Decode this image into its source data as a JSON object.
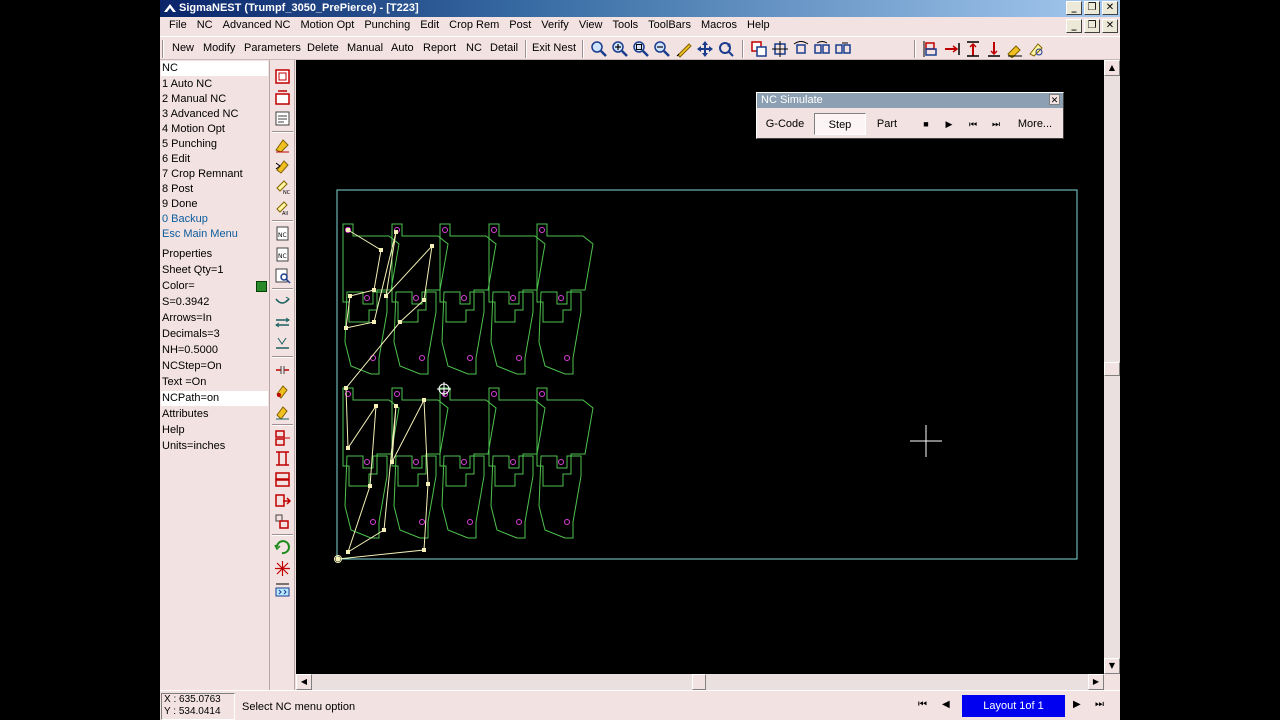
{
  "window": {
    "app_name": "SigmaNEST",
    "title": "SigmaNEST    (Trumpf_3050_PrePierce)  - [T223]",
    "min_label": "_",
    "max_label": "❐",
    "close_label": "✕"
  },
  "menu": [
    "File",
    "NC",
    "Advanced NC",
    "Motion Opt",
    "Punching",
    "Edit",
    "Crop Rem",
    "Post",
    "Verify",
    "View",
    "Tools",
    "ToolBars",
    "Macros",
    "Help"
  ],
  "toolbar": {
    "buttons": [
      "New",
      "Modify",
      "Parameters",
      "Delete",
      "Manual",
      "Auto",
      "Report",
      "NC",
      "Detail"
    ],
    "exit_nest": "Exit Nest",
    "zoom_icons": [
      "zoom-icon",
      "zoom-in-icon",
      "zoom-window-icon",
      "zoom-out-icon",
      "measure-icon",
      "pan-icon",
      "refresh-icon"
    ],
    "nest_icons": [
      "part-copy-icon",
      "move-part-icon",
      "rotate-part-icon",
      "mirror-part-icon",
      "array-part-icon"
    ],
    "align_icons": [
      "align-left-icon",
      "align-right-icon",
      "align-top-icon",
      "align-bottom-icon",
      "fill-icon",
      "bump-icon"
    ]
  },
  "left_panel": {
    "menu_header": "NC",
    "menu_items": [
      "1 Auto NC",
      "2 Manual NC",
      "3 Advanced NC",
      "4 Motion Opt",
      "5 Punching",
      "6 Edit",
      "7 Crop Remnant",
      "8 Post",
      "9 Done"
    ],
    "backup": "0 Backup",
    "main_menu": "Esc Main Menu",
    "properties": [
      "Properties",
      "Sheet Qty=1",
      "Color=",
      "S=0.3942",
      "Arrows=In",
      "Decimals=3",
      "NH=0.5000",
      "NCStep=On",
      "Text  =On",
      "NCPath=on",
      "Attributes",
      "Help",
      "Units=inches"
    ],
    "sheet_color": "#2a8a2a"
  },
  "nc_simulate": {
    "title": "NC Simulate",
    "close": "✕",
    "gcode": "G-Code",
    "step": "Step",
    "part": "Part",
    "stop": "■",
    "play": "▶",
    "prev": "⏮",
    "next": "⏭",
    "more": "More..."
  },
  "status": {
    "x": "X : 635.0763",
    "y": "Y : 534.0414",
    "message": "Select NC menu option",
    "layout": "Layout 1of 1",
    "nav_first": "⏮",
    "nav_prev": "◀",
    "nav_next": "▶",
    "nav_last": "⏭"
  },
  "scroll": {
    "up": "▲",
    "down": "▼",
    "left": "◀",
    "right": "▶"
  },
  "colors": {
    "part_outline": "#4ec24e",
    "sheet_outline": "#7fd8d8",
    "nc_path": "#f4f0b8",
    "pierce": "#e040e0",
    "layout_tab": "#0000f0"
  }
}
